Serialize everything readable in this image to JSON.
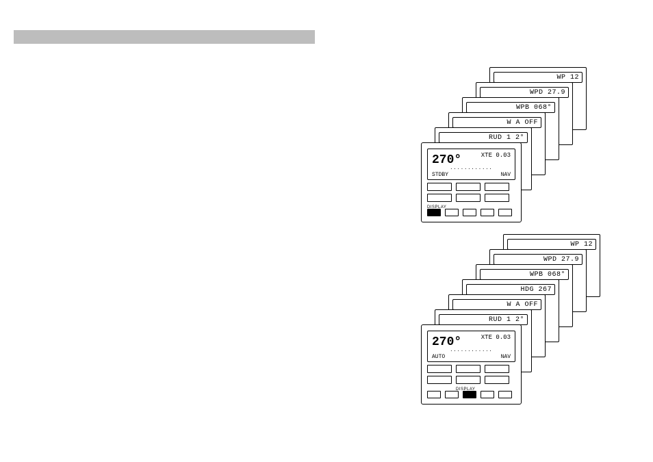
{
  "header_bar": "",
  "top_stack": {
    "minis": [
      {
        "text": "WP   12"
      },
      {
        "text": "WPD 27.9"
      },
      {
        "text": "WPB 068°"
      },
      {
        "text": "W A OFF"
      },
      {
        "text": "RUD 1 2°"
      }
    ],
    "device": {
      "big": "270°",
      "small": "XTE 0.03",
      "mid": "............",
      "mode_left": "STDBY",
      "mode_right": "NAV",
      "bottom_label": "DISPLAY"
    }
  },
  "bot_stack": {
    "minis": [
      {
        "text": "WP   12"
      },
      {
        "text": "WPD 27.9"
      },
      {
        "text": "WPB 068°"
      },
      {
        "text": "HDG 267"
      },
      {
        "text": "W A OFF"
      },
      {
        "text": "RUD 1 2°"
      }
    ],
    "device": {
      "big": "270°",
      "small": "XTE 0.03",
      "mid": "............",
      "mode_left": "AUTO",
      "mode_right": "NAV",
      "bottom_label": "DISPLAY"
    }
  }
}
